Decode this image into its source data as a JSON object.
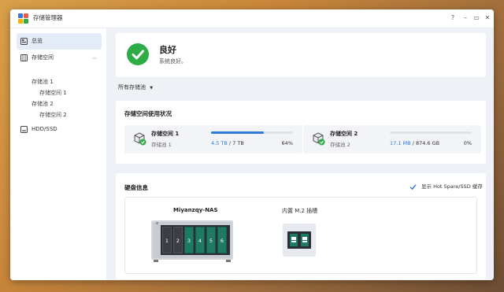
{
  "window": {
    "title": "存储管理器",
    "controls": [
      "?",
      "–",
      "▭",
      "✕"
    ]
  },
  "sidebar": {
    "items": [
      {
        "label": "总览",
        "icon": "overview-icon",
        "active": true
      },
      {
        "label": "存储空间",
        "icon": "storage-icon",
        "expanded": true
      },
      {
        "label": "HDD/SSD",
        "icon": "drive-icon"
      }
    ],
    "tree": [
      {
        "label": "存储池 1"
      },
      {
        "label": "存储空间 1"
      },
      {
        "label": "存储池 2"
      },
      {
        "label": "存储空间 2"
      }
    ]
  },
  "status": {
    "title": "良好",
    "description": "系统良好。",
    "color": "#2dac48"
  },
  "pool_filter": {
    "label": "所有存储池"
  },
  "usage": {
    "title": "存储空间使用状况",
    "volumes": [
      {
        "name": "存储空间 1",
        "pool": "存储池 1",
        "used": "4.5 TB",
        "total": "/ 7 TB",
        "percent_label": "64%",
        "percent": 64
      },
      {
        "name": "存储空间 2",
        "pool": "存储池 2",
        "used": "17.1 MB",
        "total": "/ 874.6 GB",
        "percent_label": "0%",
        "percent": 0
      }
    ]
  },
  "disk_info": {
    "title": "硬盘信息",
    "hotspare_label": "显示 Hot Spare/SSD 缓存",
    "hotspare_checked": true,
    "nas_name": "Miyanzqy-NAS",
    "m2_label": "内置 M.2 插槽",
    "bays": [
      "1",
      "2",
      "3",
      "4",
      "5",
      "6"
    ]
  },
  "colors": {
    "accent": "#2f7bd8",
    "ok": "#2dac48",
    "drive": "#1f7a65"
  }
}
